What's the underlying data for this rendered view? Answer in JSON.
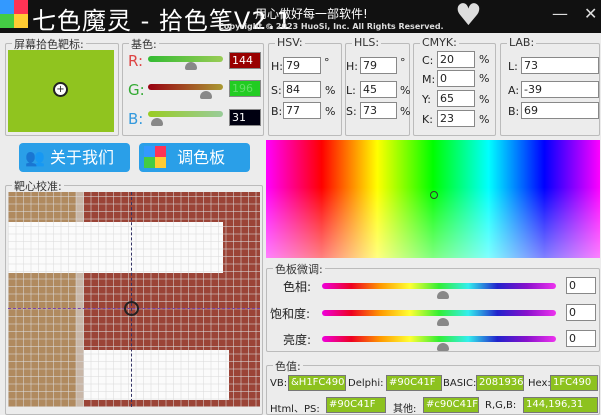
{
  "titlebar": {
    "title": "七色魔灵 - 拾色笔V2.1",
    "slogan": "用心做好每一部软件!",
    "copyright": "Copyright © 2023 HuoSi, Inc. All Rights Reserved.",
    "minimize": "—",
    "close": "✕"
  },
  "picker": {
    "label": "屏幕拾色靶标:",
    "color": "#90C41F"
  },
  "base": {
    "label": "基色:",
    "r_label": "R:",
    "g_label": "G:",
    "b_label": "B:",
    "r": "144",
    "g": "196",
    "b": "31"
  },
  "hsv": {
    "label": "HSV:",
    "h_label": "H:",
    "s_label": "S:",
    "b_label": "B:",
    "h": "79",
    "s": "84",
    "b": "77",
    "deg": "°",
    "pct": "%"
  },
  "hls": {
    "label": "HLS:",
    "h_label": "H:",
    "l_label": "L:",
    "s_label": "S:",
    "h": "79",
    "l": "45",
    "s": "73"
  },
  "cmyk": {
    "label": "CMYK:",
    "c_label": "C:",
    "m_label": "M:",
    "y_label": "Y:",
    "k_label": "K:",
    "c": "20",
    "m": "0",
    "y": "65",
    "k": "23"
  },
  "lab": {
    "label": "LAB:",
    "l_label": "L:",
    "a_label": "A:",
    "b_label": "B:",
    "l": "73",
    "a": "-39",
    "b": "69"
  },
  "buttons": {
    "about": "关于我们",
    "palette": "调色板"
  },
  "target": {
    "label": "靶心校准:"
  },
  "adjust": {
    "label": "色板微调:",
    "hue_label": "色相:",
    "sat_label": "饱和度:",
    "bri_label": "亮度:",
    "hue": "0",
    "sat": "0",
    "bri": "0"
  },
  "values": {
    "label": "色值:",
    "vb_label": "VB:",
    "vb": "&H1FC490&",
    "delphi_label": "Delphi:",
    "delphi": "#90C41F",
    "basic_label": "BASIC:",
    "basic": "2081936",
    "hex_label": "Hex:",
    "hex": "1FC490",
    "html_label": "Html、PS:",
    "html": "#90C41F",
    "other_label": "其他:",
    "other": "#c90C41F",
    "rgb_label": "R,G,B:",
    "rgb": "144,196,31"
  }
}
